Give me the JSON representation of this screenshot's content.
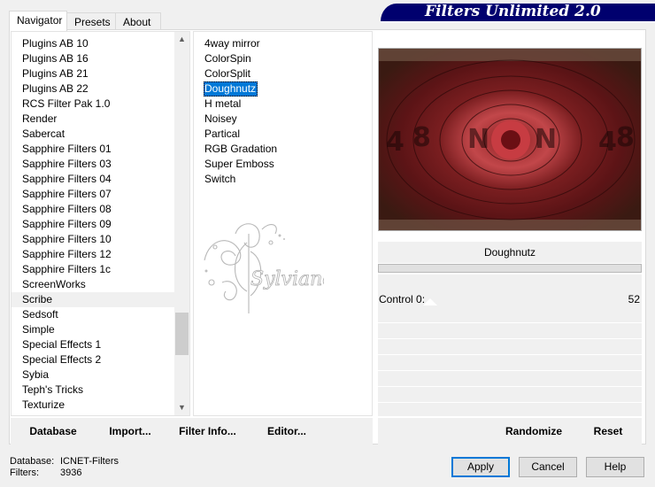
{
  "tabs": [
    "Navigator",
    "Presets",
    "About"
  ],
  "header_title": "Filters Unlimited 2.0",
  "categories": [
    "Plugins AB 10",
    "Plugins AB 16",
    "Plugins AB 21",
    "Plugins AB 22",
    "RCS Filter Pak 1.0",
    "Render",
    "Sabercat",
    "Sapphire Filters 01",
    "Sapphire Filters 03",
    "Sapphire Filters 04",
    "Sapphire Filters 07",
    "Sapphire Filters 08",
    "Sapphire Filters 09",
    "Sapphire Filters 10",
    "Sapphire Filters 12",
    "Sapphire Filters 1c",
    "ScreenWorks",
    "Scribe",
    "Sedsoft",
    "Simple",
    "Special Effects 1",
    "Special Effects 2",
    "Sybia",
    "Teph's Tricks",
    "Texturize"
  ],
  "categories_hover_index": 17,
  "filters": [
    "4way mirror",
    "ColorSpin",
    "ColorSplit",
    "Doughnutz",
    "H metal",
    "Noisey",
    "Partical",
    "RGB Gradation",
    "Super Emboss",
    "Switch"
  ],
  "filters_selected_index": 3,
  "selected_filter": "Doughnutz",
  "control": {
    "label": "Control 0:",
    "value": "52"
  },
  "left_buttons": {
    "database": "Database",
    "import": "Import...",
    "filter_info": "Filter Info...",
    "editor": "Editor..."
  },
  "right_buttons": {
    "randomize": "Randomize",
    "reset": "Reset"
  },
  "status": {
    "database_label": "Database:",
    "database_value": "ICNET-Filters",
    "filters_label": "Filters:",
    "filters_value": "3936"
  },
  "dialog_buttons": {
    "apply": "Apply",
    "cancel": "Cancel",
    "help": "Help"
  },
  "watermark_text": "Sylviane",
  "preview_icon": "doughnutz-preview-image",
  "colors": {
    "header": "#00006e",
    "selection": "#0078d7",
    "preview_dark": "#6e1a1c"
  }
}
